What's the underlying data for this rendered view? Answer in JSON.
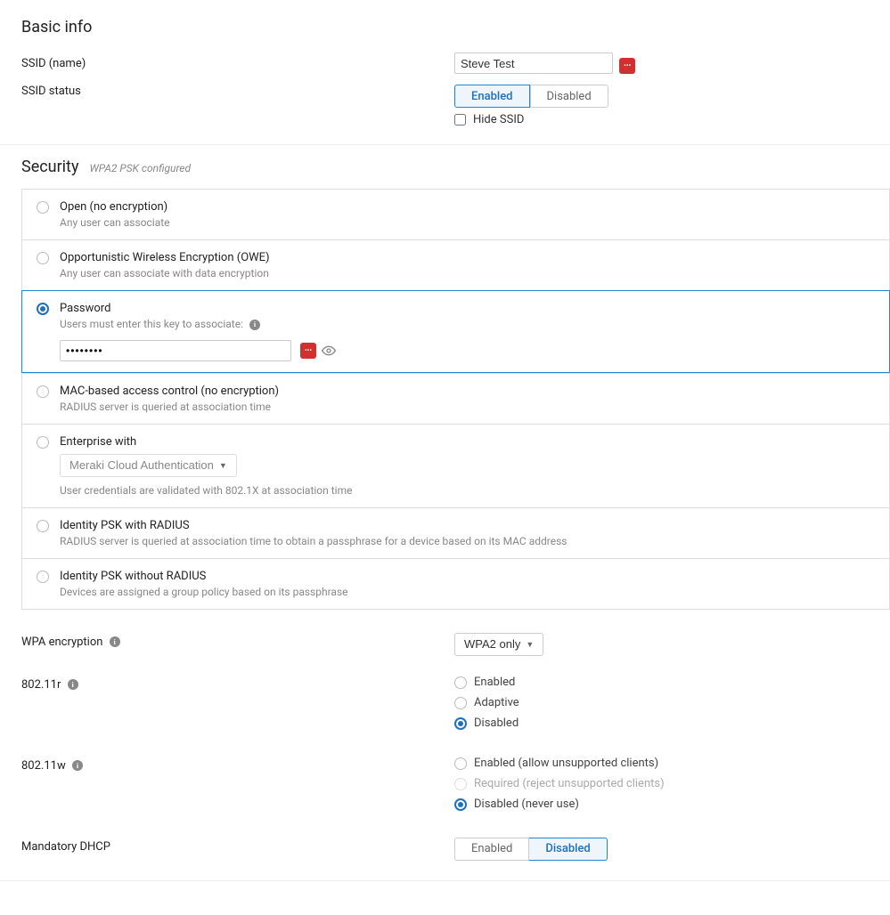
{
  "basic": {
    "heading": "Basic info",
    "ssid_label": "SSID (name)",
    "ssid_value": "Steve Test",
    "status_label": "SSID status",
    "status_enabled": "Enabled",
    "status_disabled": "Disabled",
    "hide_ssid": "Hide SSID"
  },
  "security": {
    "heading": "Security",
    "subtitle": "WPA2 PSK configured",
    "options": {
      "open": {
        "title": "Open (no encryption)",
        "desc": "Any user can associate"
      },
      "owe": {
        "title": "Opportunistic Wireless Encryption (OWE)",
        "desc": "Any user can associate with data encryption"
      },
      "password": {
        "title": "Password",
        "desc": "Users must enter this key to associate:",
        "value": "••••••••"
      },
      "mac": {
        "title": "MAC-based access control (no encryption)",
        "desc": "RADIUS server is queried at association time"
      },
      "enterprise": {
        "title": "Enterprise with",
        "select": "Meraki Cloud Authentication",
        "desc": "User credentials are validated with 802.1X at association time"
      },
      "ipsk_radius": {
        "title": "Identity PSK with RADIUS",
        "desc": "RADIUS server is queried at association time to obtain a passphrase for a device based on its MAC address"
      },
      "ipsk_noradius": {
        "title": "Identity PSK without RADIUS",
        "desc": "Devices are assigned a group policy based on its passphrase"
      }
    },
    "wpa_label": "WPA encryption",
    "wpa_value": "WPA2 only",
    "r_label": "802.11r",
    "r_enabled": "Enabled",
    "r_adaptive": "Adaptive",
    "r_disabled": "Disabled",
    "w_label": "802.11w",
    "w_enabled": "Enabled (allow unsupported clients)",
    "w_required": "Required (reject unsupported clients)",
    "w_disabled": "Disabled (never use)",
    "dhcp_label": "Mandatory DHCP",
    "dhcp_enabled": "Enabled",
    "dhcp_disabled": "Disabled"
  }
}
